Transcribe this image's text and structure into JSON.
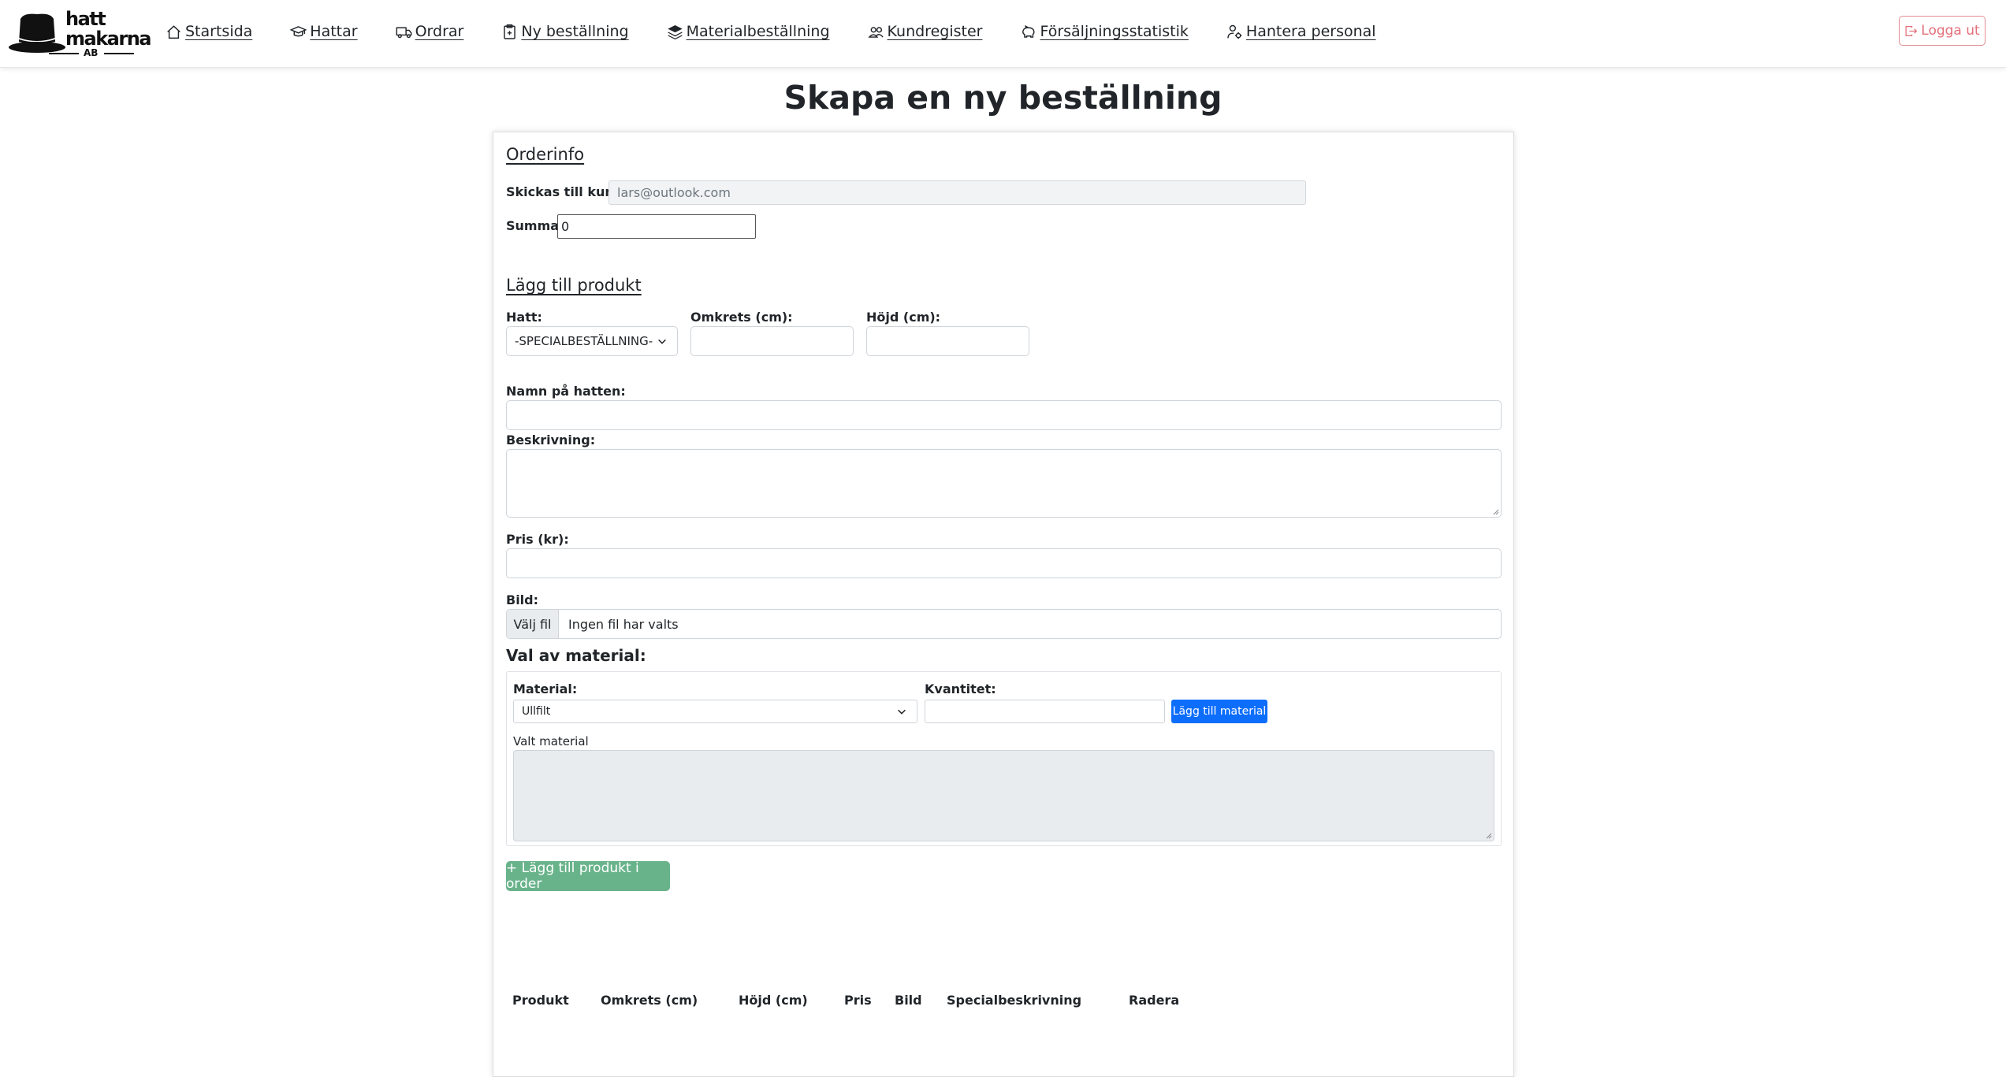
{
  "brand": {
    "name": "hatt makarna",
    "suffix": "AB"
  },
  "nav": {
    "items": [
      {
        "label": "Startsida",
        "icon": "house-icon"
      },
      {
        "label": "Hattar",
        "icon": "graduation-cap-icon"
      },
      {
        "label": "Ordrar",
        "icon": "truck-icon"
      },
      {
        "label": "Ny beställning",
        "icon": "clipboard-plus-icon"
      },
      {
        "label": "Materialbeställning",
        "icon": "layers-icon"
      },
      {
        "label": "Kundregister",
        "icon": "people-icon"
      },
      {
        "label": "Försäljningsstatistik",
        "icon": "piggy-bank-icon"
      },
      {
        "label": "Hantera personal",
        "icon": "person-gear-icon"
      }
    ],
    "logout_label": "Logga ut"
  },
  "page": {
    "title": "Skapa en ny beställning"
  },
  "orderinfo": {
    "heading": "Orderinfo",
    "customer_label": "Skickas till kund:",
    "customer_value": "lars@outlook.com",
    "sum_label": "Summa:",
    "sum_value": "0"
  },
  "product": {
    "heading": "Lägg till produkt",
    "hat_label": "Hatt:",
    "hat_selected": "-SPECIALBESTÄLLNING-",
    "circumference_label": "Omkrets (cm):",
    "circumference_value": "",
    "height_label": "Höjd (cm):",
    "height_value": "",
    "name_label": "Namn på hatten:",
    "name_value": "",
    "description_label": "Beskrivning:",
    "description_value": "",
    "price_label": "Pris (kr):",
    "price_value": "",
    "image_label": "Bild:",
    "file_button": "Välj fil",
    "file_status": "Ingen fil har valts"
  },
  "material": {
    "heading": "Val av material:",
    "material_label": "Material:",
    "material_selected": "Ullfilt",
    "quantity_label": "Kvantitet:",
    "quantity_value": "",
    "add_button": "Lägg till material",
    "selected_label": "Valt material"
  },
  "add_product_button": "+ Lägg till produkt i order",
  "table": {
    "headers": [
      "Produkt",
      "Omkrets (cm)",
      "Höjd (cm)",
      "Pris",
      "Bild",
      "Specialbeskrivning",
      "Radera"
    ]
  },
  "colors": {
    "primary": "#0d6efd",
    "success": "#69b38b",
    "danger": "#e36f7a"
  }
}
